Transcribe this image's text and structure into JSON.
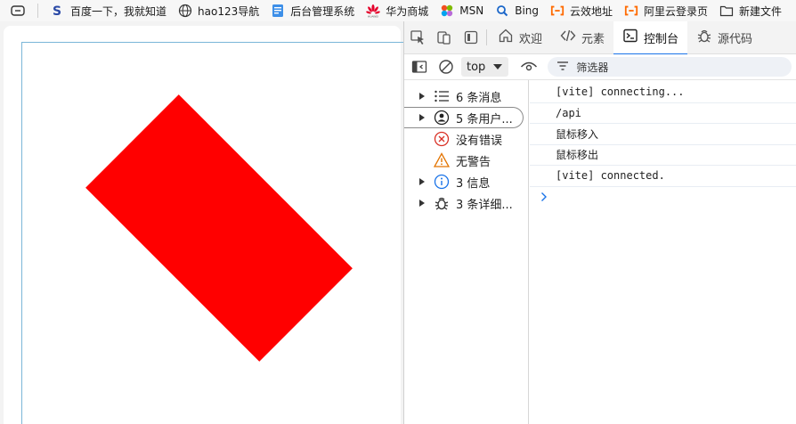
{
  "bookmarks": [
    {
      "label": "百度一下，我就知道",
      "icon": "baidu-icon"
    },
    {
      "label": "hao123导航",
      "icon": "globe-icon"
    },
    {
      "label": "后台管理系统",
      "icon": "doc-icon"
    },
    {
      "label": "华为商城",
      "icon": "huawei-icon"
    },
    {
      "label": "MSN",
      "icon": "msn-icon"
    },
    {
      "label": "Bing",
      "icon": "bing-search-icon"
    },
    {
      "label": "云效地址",
      "icon": "aliyun-icon"
    },
    {
      "label": "阿里云登录页",
      "icon": "aliyun-icon"
    },
    {
      "label": "新建文件",
      "icon": "folder-icon"
    }
  ],
  "page": {
    "shape_color": "#ff0000",
    "border_color": "#7ab6d8"
  },
  "devtools": {
    "tabs": [
      {
        "label": "欢迎",
        "icon": "home-icon"
      },
      {
        "label": "元素",
        "icon": "code-icon"
      },
      {
        "label": "控制台",
        "icon": "console-icon",
        "active": true
      },
      {
        "label": "源代码",
        "icon": "bug-icon"
      }
    ],
    "toolbar": {
      "context": "top",
      "filter_label": "筛选器"
    },
    "sidebar": [
      {
        "label": "6 条消息",
        "icon": "list-icon",
        "expandable": true
      },
      {
        "label": "5 条用户...",
        "icon": "user-icon",
        "expandable": true,
        "selected": true
      },
      {
        "label": "没有错误",
        "icon": "error-icon",
        "expandable": false
      },
      {
        "label": "无警告",
        "icon": "warning-icon",
        "expandable": false
      },
      {
        "label": "3 信息",
        "icon": "info-icon",
        "expandable": true
      },
      {
        "label": "3 条详细...",
        "icon": "verbose-bug-icon",
        "expandable": true
      }
    ],
    "console_lines": [
      "[vite] connecting...",
      "/api",
      "鼠标移入",
      "鼠标移出",
      "[vite] connected."
    ],
    "accent": "#1a73e8"
  }
}
